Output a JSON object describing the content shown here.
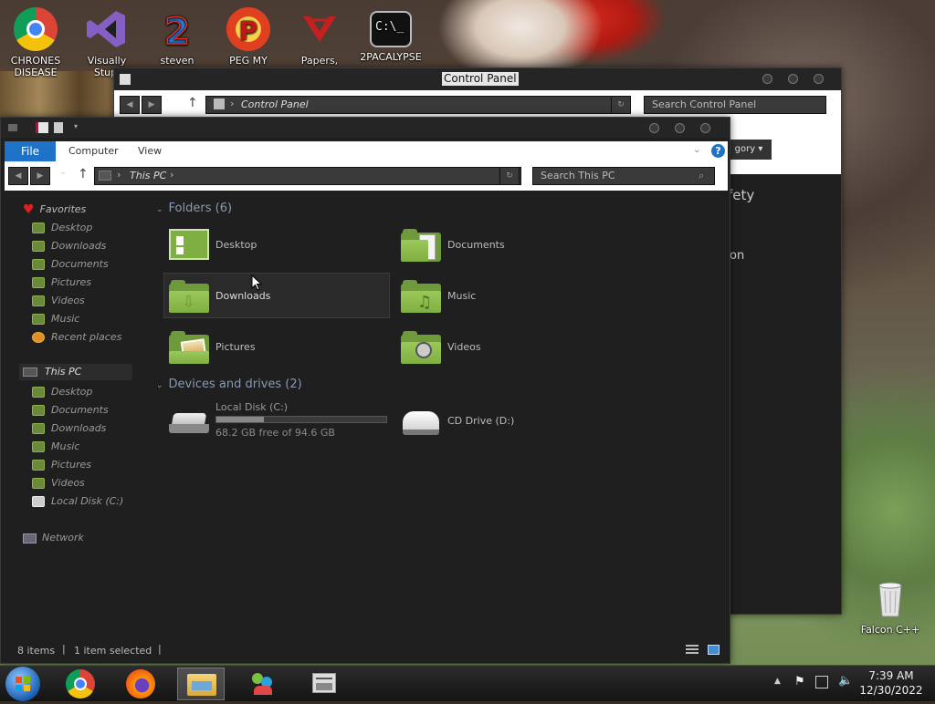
{
  "desktop": {
    "icons": [
      {
        "name": "CHRONES DISEASE",
        "lines": [
          "CHRONES",
          "DISEASE"
        ]
      },
      {
        "name": "Visually Stupid",
        "lines": [
          "Visually",
          "Stupi"
        ]
      },
      {
        "name": "steven",
        "lines": [
          "steven"
        ]
      },
      {
        "name": "PEG MY WIFE!",
        "lines": [
          "PEG MY WIFE!"
        ]
      },
      {
        "name": "Papers,",
        "lines": [
          "Papers,"
        ]
      },
      {
        "name": "2PACALYPSE",
        "lines": [
          "2PACALYPSE"
        ]
      }
    ],
    "recycle_bin_label": "Falcon C++"
  },
  "control_panel": {
    "title": "Control Panel",
    "address": "Control Panel",
    "search_placeholder": "Search Control Panel",
    "category_button": "gory",
    "partial_text_1": "fety",
    "partial_text_2": "on"
  },
  "explorer": {
    "ribbon_tabs": [
      "File",
      "Computer",
      "View"
    ],
    "help": "?",
    "address": "This PC",
    "search_placeholder": "Search This PC",
    "nav": {
      "favorites_label": "Favorites",
      "favorites": [
        "Desktop",
        "Downloads",
        "Documents",
        "Pictures",
        "Videos",
        "Music",
        "Recent places"
      ],
      "thispc_label": "This PC",
      "thispc": [
        "Desktop",
        "Documents",
        "Downloads",
        "Music",
        "Pictures",
        "Videos",
        "Local Disk (C:)"
      ],
      "network_label": "Network"
    },
    "folders_header": "Folders (6)",
    "folders": [
      "Desktop",
      "Documents",
      "Downloads",
      "Music",
      "Pictures",
      "Videos"
    ],
    "drives_header": "Devices and drives (2)",
    "drives": [
      {
        "name": "Local Disk (C:)",
        "free": "68.2 GB free of 94.6 GB",
        "used_fraction": 0.28
      },
      {
        "name": "CD Drive (D:)"
      }
    ],
    "status_items": "8 items",
    "status_selected": "1 item selected"
  },
  "taskbar": {
    "time": "7:39 AM",
    "date": "12/30/2022"
  },
  "colors": {
    "accent": "#1e73c8",
    "folder_green": "#7fae42",
    "window_bg": "#1f1f1f"
  }
}
